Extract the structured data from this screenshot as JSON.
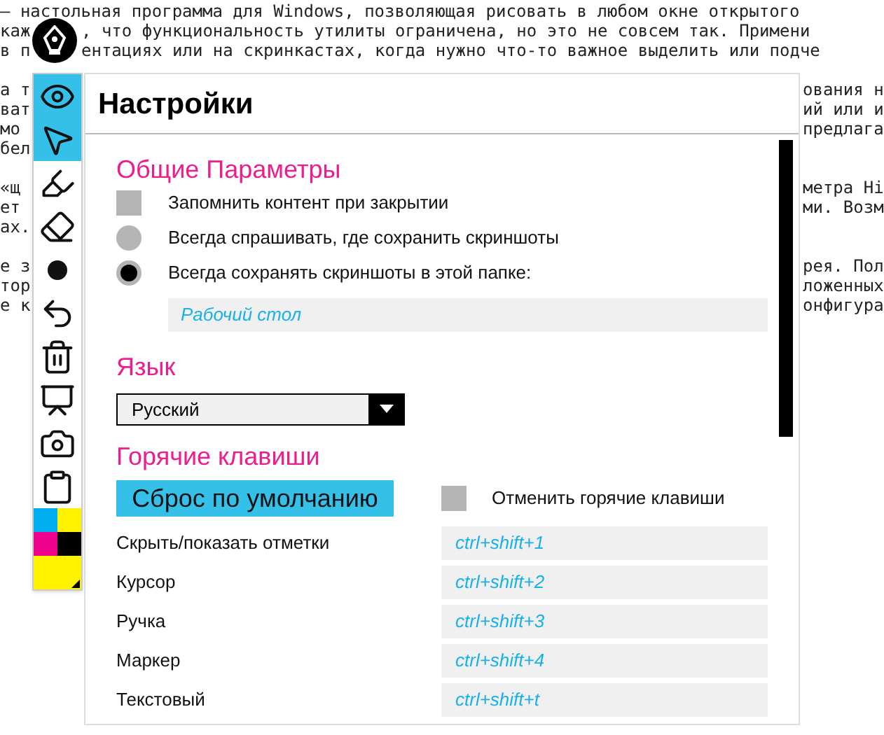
{
  "background_text": [
    {
      "kind": "full",
      "text": "– настольная программа для Windows, позволяющая рисовать в любом окне открытого"
    },
    {
      "kind": "split_top",
      "left": "каж",
      "right": ", что функциональность утилиты ограничена, но это не совсем так. Примени"
    },
    {
      "kind": "split_top",
      "left": "в п",
      "right": "ентациях или на скринкастах, когда нужно что-то важное выделить или подче"
    },
    {
      "kind": "blank"
    },
    {
      "kind": "split",
      "left": "а т",
      "right": "ования н"
    },
    {
      "kind": "split",
      "left": "ват",
      "right": "ий или и"
    },
    {
      "kind": "split",
      "left": "мо",
      "right": "предлага"
    },
    {
      "kind": "split",
      "left": "бел"
    },
    {
      "kind": "blank"
    },
    {
      "kind": "split",
      "left": "«щ",
      "right": "метра Hi"
    },
    {
      "kind": "split",
      "left": "ет",
      "right": "ми. Возм"
    },
    {
      "kind": "split",
      "left": "ах."
    },
    {
      "kind": "blank"
    },
    {
      "kind": "split",
      "left": "е з",
      "right": "рея. Пол"
    },
    {
      "kind": "split",
      "left": "тор",
      "right": "ложенных"
    },
    {
      "kind": "split",
      "left": "е к",
      "right": "онфигура"
    }
  ],
  "toolbar": {
    "tools": [
      {
        "kind": "eye",
        "selected": true
      },
      {
        "kind": "cursor",
        "selected": true
      },
      {
        "kind": "highlighter",
        "selected": false
      },
      {
        "kind": "eraser",
        "selected": false
      },
      {
        "kind": "dot",
        "selected": false
      },
      {
        "kind": "undo",
        "selected": false
      },
      {
        "kind": "trash",
        "selected": false
      },
      {
        "kind": "board",
        "selected": false
      },
      {
        "kind": "camera",
        "selected": false
      },
      {
        "kind": "clipboard",
        "selected": false
      }
    ],
    "palette": [
      {
        "kind": "swatch",
        "color": "#00aeef"
      },
      {
        "kind": "swatch",
        "color": "#fff200"
      },
      {
        "kind": "swatch",
        "color": "#ec008c"
      },
      {
        "kind": "swatch",
        "color": "#000000"
      },
      {
        "kind": "current",
        "color": "#fff200"
      }
    ]
  },
  "settings": {
    "title": "Настройки",
    "general": {
      "heading": "Общие Параметры",
      "options": [
        {
          "kind": "checkbox",
          "label": "Запомнить контент при закрытии",
          "checked": false
        },
        {
          "kind": "radio",
          "label": "Всегда спрашивать, где сохранить скриншоты",
          "selected": false
        },
        {
          "kind": "radio",
          "label": "Всегда сохранять скриншоты в этой папке:",
          "selected": true
        }
      ],
      "folder": "Рабочий стол"
    },
    "language": {
      "heading": "Язык",
      "value": "Русский"
    },
    "hotkeys": {
      "heading": "Горячие клавиши",
      "reset_button": "Сброс по умолчанию",
      "disable": {
        "label": "Отменить горячие клавиши",
        "checked": false
      },
      "items": [
        {
          "label": "Скрыть/показать отметки",
          "value": "ctrl+shift+1"
        },
        {
          "label": "Курсор",
          "value": "ctrl+shift+2"
        },
        {
          "label": "Ручка",
          "value": "ctrl+shift+3"
        },
        {
          "label": "Маркер",
          "value": "ctrl+shift+4"
        },
        {
          "label": "Текстовый",
          "value": "ctrl+shift+t"
        }
      ]
    }
  }
}
